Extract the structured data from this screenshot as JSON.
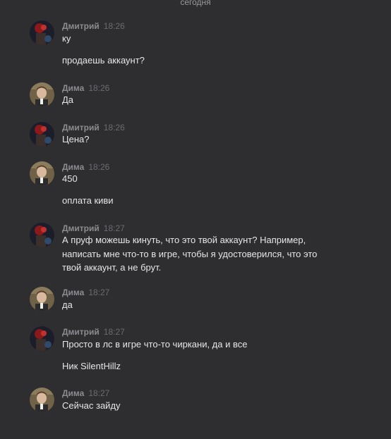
{
  "day_divider": "сегодня",
  "messages": [
    {
      "author": "Дмитрий",
      "time": "18:26",
      "avatar": "avatar-dmitriy",
      "lines": [
        "ку",
        "продаешь аккаунт?"
      ]
    },
    {
      "author": "Дима",
      "time": "18:26",
      "avatar": "avatar-dima",
      "lines": [
        "Да"
      ]
    },
    {
      "author": "Дмитрий",
      "time": "18:26",
      "avatar": "avatar-dmitriy",
      "lines": [
        "Цена?"
      ]
    },
    {
      "author": "Дима",
      "time": "18:26",
      "avatar": "avatar-dima",
      "lines": [
        "450",
        "оплата киви"
      ]
    },
    {
      "author": "Дмитрий",
      "time": "18:27",
      "avatar": "avatar-dmitriy",
      "lines": [
        "А пруф можешь кинуть, что это твой аккаунт? Например, написать мне что-то в игре, чтобы я удостоверился, что это твой аккаунт, а не брут."
      ]
    },
    {
      "author": "Дима",
      "time": "18:27",
      "avatar": "avatar-dima",
      "lines": [
        "да"
      ]
    },
    {
      "author": "Дмитрий",
      "time": "18:27",
      "avatar": "avatar-dmitriy",
      "lines": [
        "Просто в лс в игре что-то чиркани, да и все",
        "Ник SilentHillz"
      ]
    },
    {
      "author": "Дима",
      "time": "18:27",
      "avatar": "avatar-dima",
      "lines": [
        "Сейчас зайду"
      ]
    }
  ],
  "colors": {
    "background": "#2e2e31",
    "author": "#8c8c90",
    "time": "#6b6b70",
    "text": "#e6e6e8"
  }
}
